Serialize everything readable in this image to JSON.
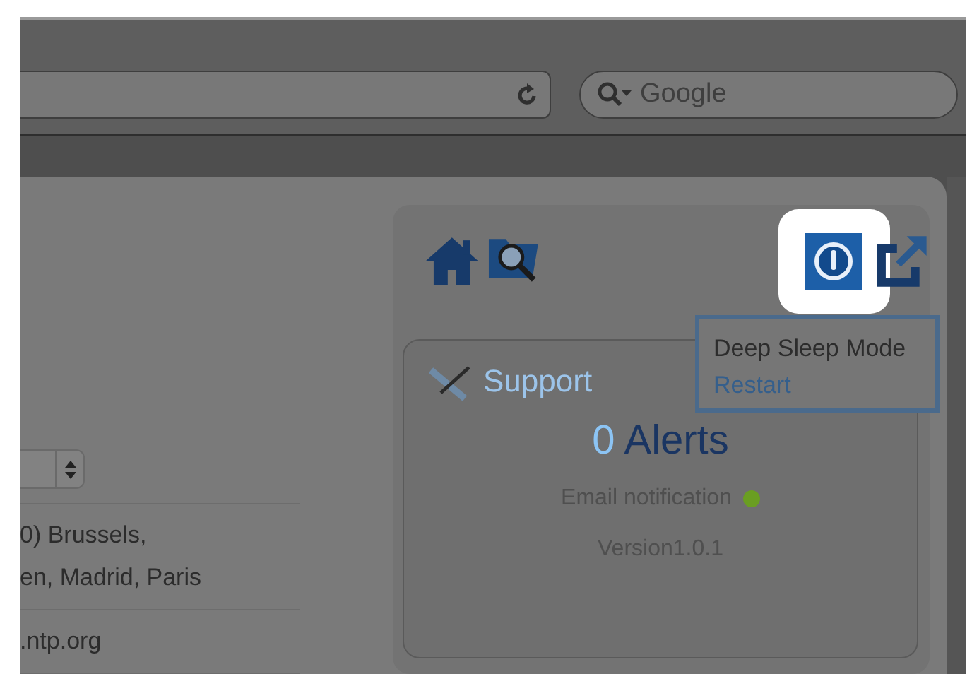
{
  "browser": {
    "search": {
      "placeholder": "Google"
    }
  },
  "settings": {
    "rows": [
      {
        "lines": [
          "0) Brussels,",
          "en, Madrid, Paris"
        ]
      },
      {
        "lines": [
          ".ntp.org"
        ]
      }
    ]
  },
  "power_menu": {
    "highlighted": true,
    "items": [
      {
        "label": "Deep Sleep Mode",
        "kind": "text"
      },
      {
        "label": "Restart",
        "kind": "link"
      }
    ]
  },
  "support": {
    "title": "Support",
    "alert_count": "0",
    "alert_label": "Alerts",
    "email_notification": {
      "label": "Email notification",
      "on": true
    },
    "version": "Version1.0.1"
  }
}
